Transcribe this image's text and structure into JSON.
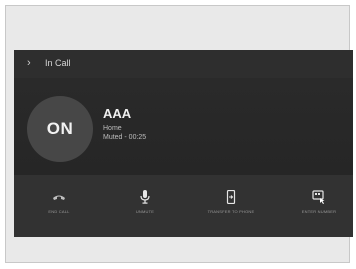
{
  "header": {
    "back_glyph": "›",
    "title": "In Call"
  },
  "call": {
    "status": "ON",
    "caller_name": "AAA",
    "caller_type": "Home",
    "call_status": "Muted - 00:25"
  },
  "actions": [
    {
      "label": "END CALL",
      "icon": "end-call-icon"
    },
    {
      "label": "UNMUTE",
      "icon": "microphone-icon"
    },
    {
      "label": "TRANSFER TO PHONE",
      "icon": "phone-transfer-icon"
    },
    {
      "label": "ENTER NUMBER",
      "icon": "keypad-icon"
    }
  ],
  "colors": {
    "screen_bg": "#2b2b2b",
    "status_circle": "#474747",
    "text_primary": "#f0f0f0"
  }
}
